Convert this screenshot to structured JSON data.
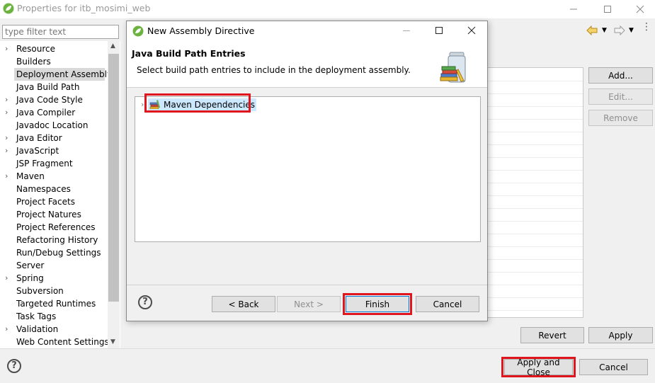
{
  "window": {
    "title": "Properties for itb_mosimi_web",
    "filter_placeholder": "type filter text"
  },
  "tree": {
    "items": [
      {
        "label": "Resource",
        "expandable": true
      },
      {
        "label": "Builders",
        "expandable": false
      },
      {
        "label": "Deployment Assembly",
        "expandable": false,
        "selected": true
      },
      {
        "label": "Java Build Path",
        "expandable": false
      },
      {
        "label": "Java Code Style",
        "expandable": true
      },
      {
        "label": "Java Compiler",
        "expandable": true
      },
      {
        "label": "Javadoc Location",
        "expandable": false
      },
      {
        "label": "Java Editor",
        "expandable": true
      },
      {
        "label": "JavaScript",
        "expandable": true
      },
      {
        "label": "JSP Fragment",
        "expandable": false
      },
      {
        "label": "Maven",
        "expandable": true
      },
      {
        "label": "Namespaces",
        "expandable": false
      },
      {
        "label": "Project Facets",
        "expandable": false
      },
      {
        "label": "Project Natures",
        "expandable": false
      },
      {
        "label": "Project References",
        "expandable": false
      },
      {
        "label": "Refactoring History",
        "expandable": false
      },
      {
        "label": "Run/Debug Settings",
        "expandable": false
      },
      {
        "label": "Server",
        "expandable": false
      },
      {
        "label": "Spring",
        "expandable": true
      },
      {
        "label": "Subversion",
        "expandable": false
      },
      {
        "label": "Targeted Runtimes",
        "expandable": false
      },
      {
        "label": "Task Tags",
        "expandable": false
      },
      {
        "label": "Validation",
        "expandable": true
      },
      {
        "label": "Web Content Settings",
        "expandable": false
      }
    ]
  },
  "assembly_panel": {
    "add_label": "Add...",
    "edit_label": "Edit...",
    "remove_label": "Remove",
    "revert_label": "Revert",
    "apply_label": "Apply"
  },
  "footer": {
    "apply_close_label": "Apply and Close",
    "cancel_label": "Cancel"
  },
  "dialog": {
    "title": "New Assembly Directive",
    "header_title": "Java Build Path Entries",
    "header_description": "Select build path entries to include in the deployment assembly.",
    "entries": [
      {
        "label": "Maven Dependencies",
        "highlighted": true
      }
    ],
    "back_label": "< Back",
    "next_label": "Next >",
    "finish_label": "Finish",
    "cancel_label": "Cancel"
  },
  "colors": {
    "highlight": "#e0161f",
    "selection": "#cce8ff",
    "spring_green": "#6db33f"
  }
}
